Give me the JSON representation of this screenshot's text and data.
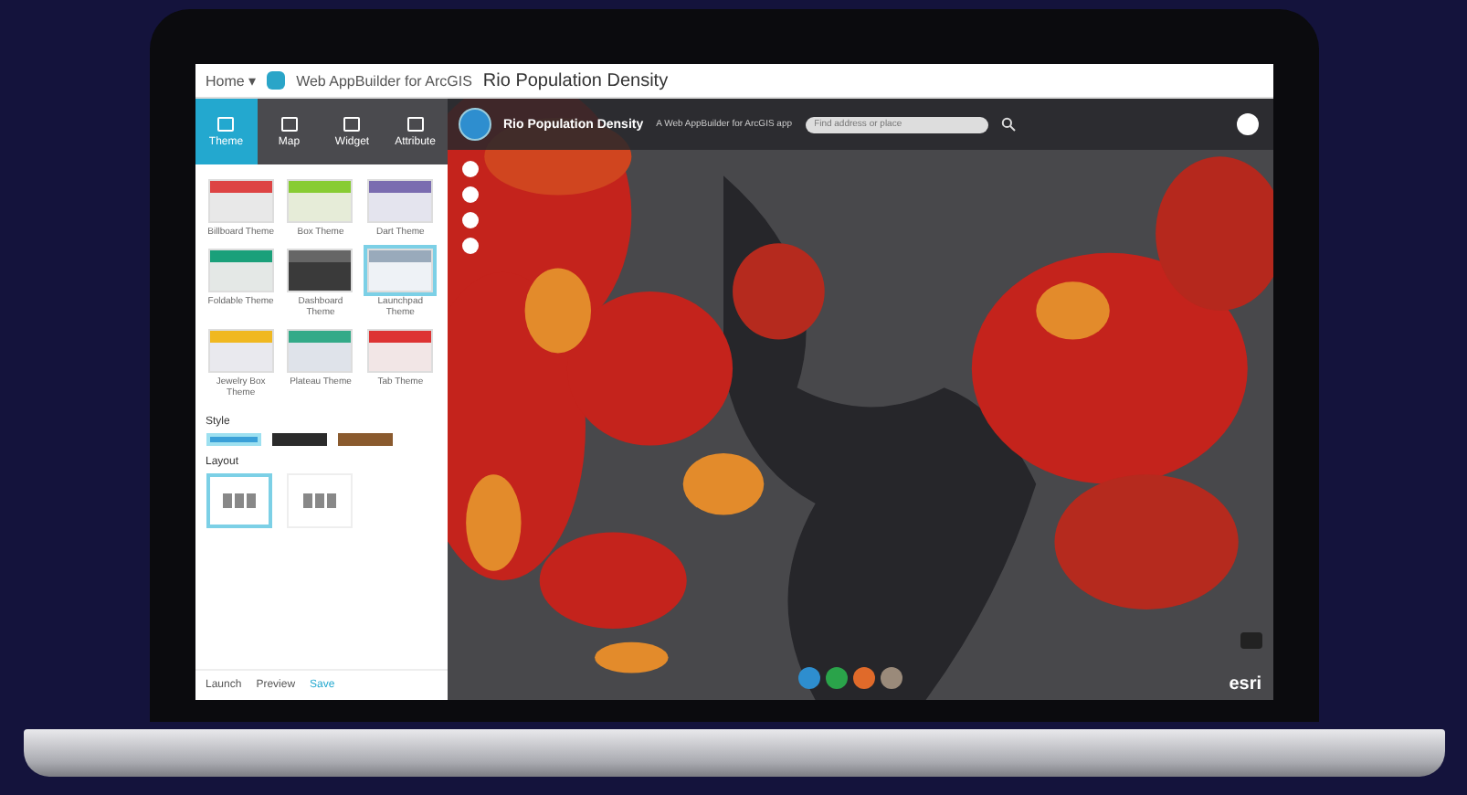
{
  "browser_bar": {
    "home": "Home ▾",
    "product": "Web AppBuilder for ArcGIS",
    "app_title": "Rio Population Density"
  },
  "tabs": [
    {
      "label": "Theme",
      "selected": true
    },
    {
      "label": "Map",
      "selected": false
    },
    {
      "label": "Widget",
      "selected": false
    },
    {
      "label": "Attribute",
      "selected": false
    }
  ],
  "themes": [
    {
      "name": "Billboard Theme",
      "selected": false
    },
    {
      "name": "Box Theme",
      "selected": false
    },
    {
      "name": "Dart Theme",
      "selected": false
    },
    {
      "name": "Foldable Theme",
      "selected": false
    },
    {
      "name": "Dashboard Theme",
      "selected": false
    },
    {
      "name": "Launchpad Theme",
      "selected": true
    },
    {
      "name": "Jewelry Box Theme",
      "selected": false
    },
    {
      "name": "Plateau Theme",
      "selected": false
    },
    {
      "name": "Tab Theme",
      "selected": false
    }
  ],
  "style": {
    "label": "Style",
    "swatches": [
      {
        "color": "#3aa0d8",
        "selected": true
      },
      {
        "color": "#2b2b2b",
        "selected": false
      },
      {
        "color": "#8a5a2e",
        "selected": false
      }
    ]
  },
  "layout": {
    "label": "Layout",
    "options": [
      {
        "selected": true
      },
      {
        "selected": false
      }
    ]
  },
  "footer": {
    "launch": "Launch",
    "preview": "Preview",
    "save": "Save"
  },
  "map": {
    "title": "Rio Population Density",
    "subtitle": "A Web AppBuilder for ArcGIS app",
    "search": {
      "placeholder": "Find address or place"
    },
    "logo": "esri"
  }
}
